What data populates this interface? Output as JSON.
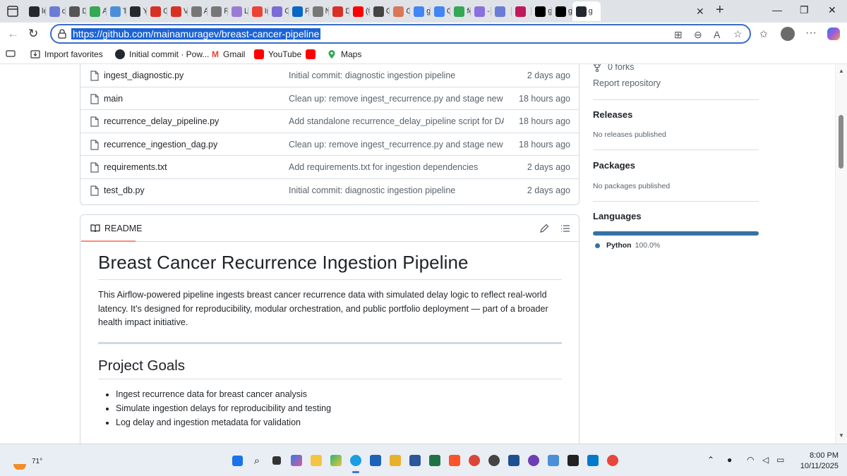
{
  "browser": {
    "tabs": [
      {
        "label": "le",
        "icon": "github-icon",
        "color": "#24292f"
      },
      {
        "label": "d",
        "icon": "notes-icon",
        "color": "#6b7cd6"
      },
      {
        "label": "D",
        "icon": "sparkle-icon",
        "color": "#555555"
      },
      {
        "label": "A",
        "icon": "sheet-icon",
        "color": "#34a853"
      },
      {
        "label": "T",
        "icon": "doc-icon",
        "color": "#4a90d9"
      },
      {
        "label": "Y",
        "icon": "github-icon",
        "color": "#24292f"
      },
      {
        "label": "O",
        "icon": "pdf-icon",
        "color": "#d93025"
      },
      {
        "label": "V",
        "icon": "pdf-icon",
        "color": "#d93025"
      },
      {
        "label": "A",
        "icon": "globe-icon",
        "color": "#777777"
      },
      {
        "label": "F",
        "icon": "settings-icon",
        "color": "#777777"
      },
      {
        "label": "L",
        "icon": "profile-icon",
        "color": "#9a7cd6"
      },
      {
        "label": "Ir",
        "icon": "gmail-icon",
        "color": "#ea4335"
      },
      {
        "label": "C",
        "icon": "star-icon",
        "color": "#7a6bd6"
      },
      {
        "label": "F",
        "icon": "linkedin-icon",
        "color": "#0a66c2"
      },
      {
        "label": "N",
        "icon": "settings-icon",
        "color": "#777777"
      },
      {
        "label": "D",
        "icon": "pdf-icon",
        "color": "#d93025"
      },
      {
        "label": "(t",
        "icon": "youtube-icon",
        "color": "#ff0000"
      },
      {
        "label": "C",
        "icon": "shield-icon",
        "color": "#444444"
      },
      {
        "label": "C",
        "icon": "asterisk-icon",
        "color": "#d97757"
      },
      {
        "label": "g",
        "icon": "search-icon",
        "color": "#4285f4"
      },
      {
        "label": "G",
        "icon": "google-icon",
        "color": "#4285f4"
      },
      {
        "label": "fc",
        "icon": "sheet-icon",
        "color": "#34a853"
      },
      {
        "label": "-",
        "icon": "copilot-icon",
        "color": "#8a6fe0"
      },
      {
        "label": "",
        "icon": "image-icon",
        "color": "#6b7cd6"
      },
      {
        "label": "",
        "icon": "ribbon-icon",
        "color": "#c2185b"
      },
      {
        "label": "g",
        "icon": "x-icon",
        "color": "#000000"
      },
      {
        "label": "g",
        "icon": "x-icon",
        "color": "#000000"
      },
      {
        "label": "g",
        "icon": "github-icon",
        "color": "#24292f",
        "active": true
      }
    ],
    "url": "https://github.com/mainamuragev/breast-cancer-pipeline",
    "bookmarks": [
      {
        "label": "Import favorites",
        "icon": "import-icon"
      },
      {
        "label": "Initial commit · Pow...",
        "icon": "github-icon"
      },
      {
        "label": "Gmail",
        "icon": "gmail-icon"
      },
      {
        "label": "YouTube",
        "icon": "youtube-icon"
      },
      {
        "label": "",
        "icon": "youtube-icon"
      },
      {
        "label": "Maps",
        "icon": "maps-icon"
      }
    ]
  },
  "repo": {
    "files": [
      {
        "name": "ingest_diagnostic.py",
        "message": "Initial commit: diagnostic ingestion pipeline",
        "date": "2 days ago"
      },
      {
        "name": "main",
        "message": "Clean up: remove ingest_recurrence.py and stage new files f...",
        "date": "18 hours ago"
      },
      {
        "name": "recurrence_delay_pipeline.py",
        "message": "Add standalone recurrence_delay_pipeline script for DAG lo...",
        "date": "18 hours ago"
      },
      {
        "name": "recurrence_ingestion_dag.py",
        "message": "Clean up: remove ingest_recurrence.py and stage new files f...",
        "date": "18 hours ago"
      },
      {
        "name": "requirements.txt",
        "message": "Add requirements.txt for ingestion dependencies",
        "date": "2 days ago"
      },
      {
        "name": "test_db.py",
        "message": "Initial commit: diagnostic ingestion pipeline",
        "date": "2 days ago"
      }
    ],
    "readme": {
      "tab_label": "README",
      "title": "Breast Cancer Recurrence Ingestion Pipeline",
      "intro": "This Airflow-powered pipeline ingests breast cancer recurrence data with simulated delay logic to reflect real-world latency. It’s designed for reproducibility, modular orchestration, and public portfolio deployment — part of a broader health impact initiative.",
      "goals_title": "Project Goals",
      "goals": [
        "Ingest recurrence data for breast cancer analysis",
        "Simulate ingestion delays for reproducibility and testing",
        "Log delay and ingestion metadata for validation"
      ]
    },
    "sidebar": {
      "forks": "0 forks",
      "report": "Report repository",
      "releases_title": "Releases",
      "releases_text": "No releases published",
      "packages_title": "Packages",
      "packages_text": "No packages published",
      "languages_title": "Languages",
      "language_name": "Python",
      "language_pct": "100.0%",
      "language_color": "#3572a5"
    }
  },
  "taskbar": {
    "temperature": "71°",
    "time": "8:00 PM",
    "date": "10/11/2025"
  }
}
